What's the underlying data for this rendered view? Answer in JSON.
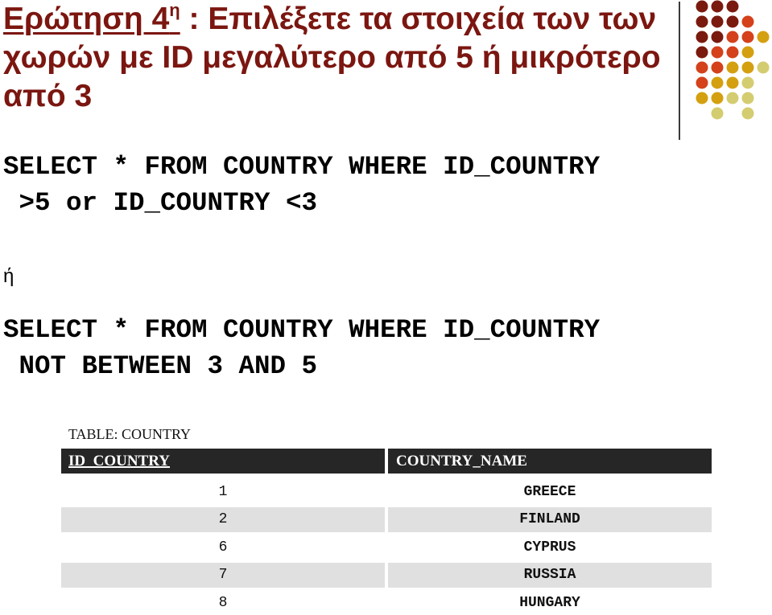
{
  "slide": {
    "title": {
      "question_label": "Ερώτηση 4",
      "question_superscript": "η",
      "text": " : Επιλέξετε τα στοιχεία των των χωρών με ID μεγαλύτερο από 5 ή μικρότερο από 3"
    },
    "queries": {
      "query1": "SELECT * FROM COUNTRY WHERE ID_COUNTRY\n >5 or ID_COUNTRY <3",
      "separator": "ή",
      "query2": "SELECT * FROM COUNTRY WHERE ID_COUNTRY\n NOT BETWEEN 3 AND 5"
    },
    "result_table": {
      "caption": "TABLE: COUNTRY",
      "columns": [
        "ID_COUNTRY",
        "COUNTRY_NAME"
      ],
      "rows": [
        [
          "1",
          "GREECE"
        ],
        [
          "2",
          "FINLAND"
        ],
        [
          "6",
          "CYPRUS"
        ],
        [
          "7",
          "RUSSIA"
        ],
        [
          "8",
          "HUNGARY"
        ]
      ]
    },
    "theme_colors": {
      "title": "#7b1610",
      "dot_maroon": "#7a1a0f",
      "dot_red": "#d4411a",
      "dot_gold": "#d4a010",
      "dot_olive": "#d4cc70",
      "header_bg": "#262626",
      "row_shade": "#e0e0e0"
    }
  }
}
